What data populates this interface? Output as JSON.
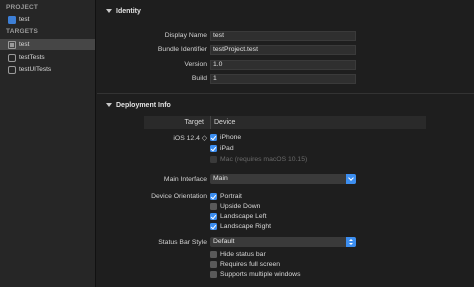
{
  "sidebar": {
    "project_header": "PROJECT",
    "project_item": "test",
    "targets_header": "TARGETS",
    "targets": [
      {
        "label": "test"
      },
      {
        "label": "testTests"
      },
      {
        "label": "testUITests"
      }
    ]
  },
  "identity": {
    "title": "Identity",
    "display_name_label": "Display Name",
    "display_name": "test",
    "bundle_id_label": "Bundle Identifier",
    "bundle_id": "testProject.test",
    "version_label": "Version",
    "version": "1.0",
    "build_label": "Build",
    "build": "1"
  },
  "deployment": {
    "title": "Deployment Info",
    "table_target_header": "Target",
    "table_device_header": "Device",
    "ios_label": "iOS 12.4 ◇",
    "devices": [
      {
        "label": "iPhone",
        "checked": true
      },
      {
        "label": "iPad",
        "checked": true
      },
      {
        "label": "Mac (requires macOS 10.15)",
        "checked": false,
        "disabled": true
      }
    ],
    "main_interface_label": "Main Interface",
    "main_interface": "Main",
    "orientation_label": "Device Orientation",
    "orientations": [
      {
        "label": "Portrait",
        "checked": true
      },
      {
        "label": "Upside Down",
        "checked": false
      },
      {
        "label": "Landscape Left",
        "checked": true
      },
      {
        "label": "Landscape Right",
        "checked": true
      }
    ],
    "status_bar_label": "Status Bar Style",
    "status_bar_style": "Default",
    "status_options": [
      {
        "label": "Hide status bar",
        "checked": false
      },
      {
        "label": "Requires full screen",
        "checked": false
      },
      {
        "label": "Supports multiple windows",
        "checked": false
      }
    ]
  },
  "colors": {
    "accent": "#3c8ef0",
    "background": "#1e1e1e",
    "sidebar": "#262626"
  }
}
